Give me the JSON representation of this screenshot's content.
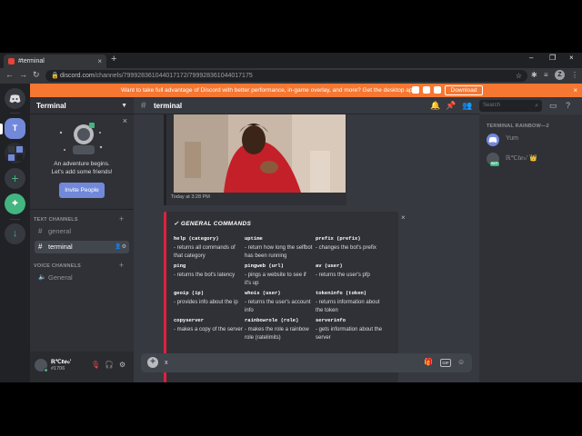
{
  "browser": {
    "tab_title": "#terminal",
    "tab_close": "×",
    "new_tab": "+",
    "window_controls": [
      "–",
      "❐",
      "×"
    ],
    "url_domain": "discord.com",
    "url_path": "/channels/799928361044017172/799928361044017175"
  },
  "banner": {
    "text": "Want to take full advantage of Discord with better performance, in-game overlay, and more? Get the desktop app!",
    "download_label": "Download",
    "close": "×"
  },
  "guilds": {
    "server_initial": "T",
    "add_label": "+",
    "explore_label": "⌖",
    "download_label": "↓"
  },
  "sidebar": {
    "server_name": "Terminal",
    "welcome_close": "×",
    "welcome_line1": "An adventure begins.",
    "welcome_line2": "Let's add some friends!",
    "invite_label": "Invite People",
    "text_category": "TEXT CHANNELS",
    "voice_category": "VOICE CHANNELS",
    "channels": [
      {
        "name": "general"
      },
      {
        "name": "terminal"
      }
    ],
    "voice_channels": [
      {
        "name": "General"
      }
    ]
  },
  "user": {
    "name": "ℝ℃ℓℯℴ'",
    "tag": "#1706"
  },
  "chat": {
    "channel": "terminal",
    "image_time": "Today at 3:28 PM",
    "embed_title": "✓ GENERAL COMMANDS",
    "embed_close": "×",
    "fields": [
      {
        "name": "help (category)",
        "value": "- returns all commands of that category"
      },
      {
        "name": "uptime",
        "value": "- return how long the selfbot has been running"
      },
      {
        "name": "prefix (prefix)",
        "value": "- changes the bot's prefix"
      },
      {
        "name": "ping",
        "value": "- returns the bot's latency"
      },
      {
        "name": "pingweb (url)",
        "value": "- pings a website to see if it's up"
      },
      {
        "name": "av (user)",
        "value": "- returns the user's pfp"
      },
      {
        "name": "geoip (ip)",
        "value": "- provides info about the ip"
      },
      {
        "name": "whois (user)",
        "value": "- returns the user's account info"
      },
      {
        "name": "tokeninfo (token)",
        "value": "- returns information about the token"
      },
      {
        "name": "copyserver",
        "value": "- makes a copy of the server"
      },
      {
        "name": "rainbowrole (role)",
        "value": "- makes the role a rainbow role (ratelimits)"
      },
      {
        "name": "serverinfo",
        "value": "- gets information about the server"
      }
    ],
    "composer_value": "x"
  },
  "header": {
    "search_placeholder": "Search"
  },
  "members": {
    "category": "TERMINAL RAINBOW—2",
    "list": [
      {
        "name": "Yum",
        "badge": ""
      },
      {
        "name": "ℝ℃ℓℯℴ' 👑",
        "badge": "BOT"
      }
    ]
  },
  "colors": {
    "accent": "#7289da",
    "banner": "#f57731",
    "embed_bar": "#e02040",
    "online": "#43b581"
  }
}
